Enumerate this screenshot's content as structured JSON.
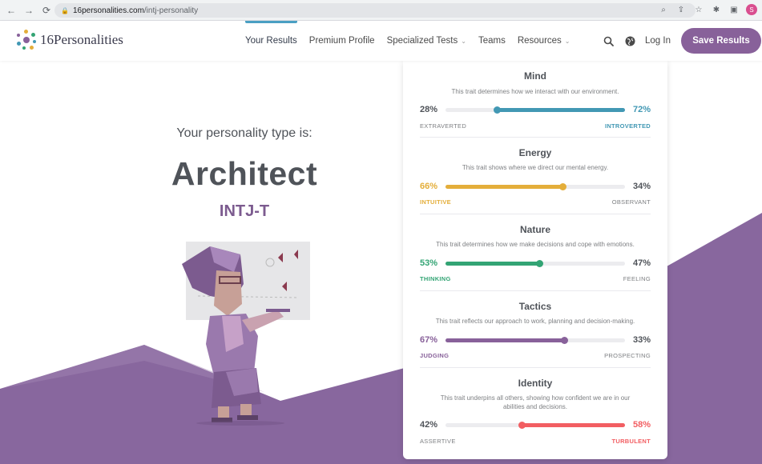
{
  "browser": {
    "url_host": "16personalities.com",
    "url_path": "/intj-personality",
    "profile_initial": "S"
  },
  "header": {
    "logo_text": "16Personalities",
    "nav": [
      {
        "label": "Your Results",
        "active": true,
        "has_caret": false
      },
      {
        "label": "Premium Profile",
        "active": false,
        "has_caret": false
      },
      {
        "label": "Specialized Tests",
        "active": false,
        "has_caret": true
      },
      {
        "label": "Teams",
        "active": false,
        "has_caret": false
      },
      {
        "label": "Resources",
        "active": false,
        "has_caret": true
      }
    ],
    "login_label": "Log In",
    "save_label": "Save Results"
  },
  "hero": {
    "subtitle": "Your personality type is:",
    "type_name": "Architect",
    "type_code": "INTJ-T"
  },
  "traits": [
    {
      "title": "Mind",
      "description": "This trait determines how we interact with our environment.",
      "left_pct": "28%",
      "right_pct": "72%",
      "left_label": "EXTRAVERTED",
      "right_label": "INTROVERTED",
      "dominant": "right",
      "fill_fraction": 0.72,
      "color": "#4298b4"
    },
    {
      "title": "Energy",
      "description": "This trait shows where we direct our mental energy.",
      "left_pct": "66%",
      "right_pct": "34%",
      "left_label": "INTUITIVE",
      "right_label": "OBSERVANT",
      "dominant": "left",
      "fill_fraction": 0.66,
      "color": "#e4ae3a"
    },
    {
      "title": "Nature",
      "description": "This trait determines how we make decisions and cope with emotions.",
      "left_pct": "53%",
      "right_pct": "47%",
      "left_label": "THINKING",
      "right_label": "FEELING",
      "dominant": "left",
      "fill_fraction": 0.53,
      "color": "#33a474"
    },
    {
      "title": "Tactics",
      "description": "This trait reflects our approach to work, planning and decision-making.",
      "left_pct": "67%",
      "right_pct": "33%",
      "left_label": "JUDGING",
      "right_label": "PROSPECTING",
      "dominant": "left",
      "fill_fraction": 0.67,
      "color": "#88619a"
    },
    {
      "title": "Identity",
      "description": "This trait underpins all others, showing how confident we are in our abilities and decisions.",
      "left_pct": "42%",
      "right_pct": "58%",
      "left_label": "ASSERTIVE",
      "right_label": "TURBULENT",
      "dominant": "right",
      "fill_fraction": 0.58,
      "color": "#f25e62"
    }
  ],
  "colors": {
    "brand_purple": "#88619a",
    "bg_purple": "#88679e",
    "heading_gray": "#4f5359"
  },
  "icons": [
    "back-arrow-icon",
    "forward-arrow-icon",
    "reload-icon",
    "lock-icon",
    "zoom-icon",
    "share-icon",
    "star-icon",
    "extension-icon",
    "sidebar-icon",
    "search-icon",
    "language-globe-icon"
  ]
}
